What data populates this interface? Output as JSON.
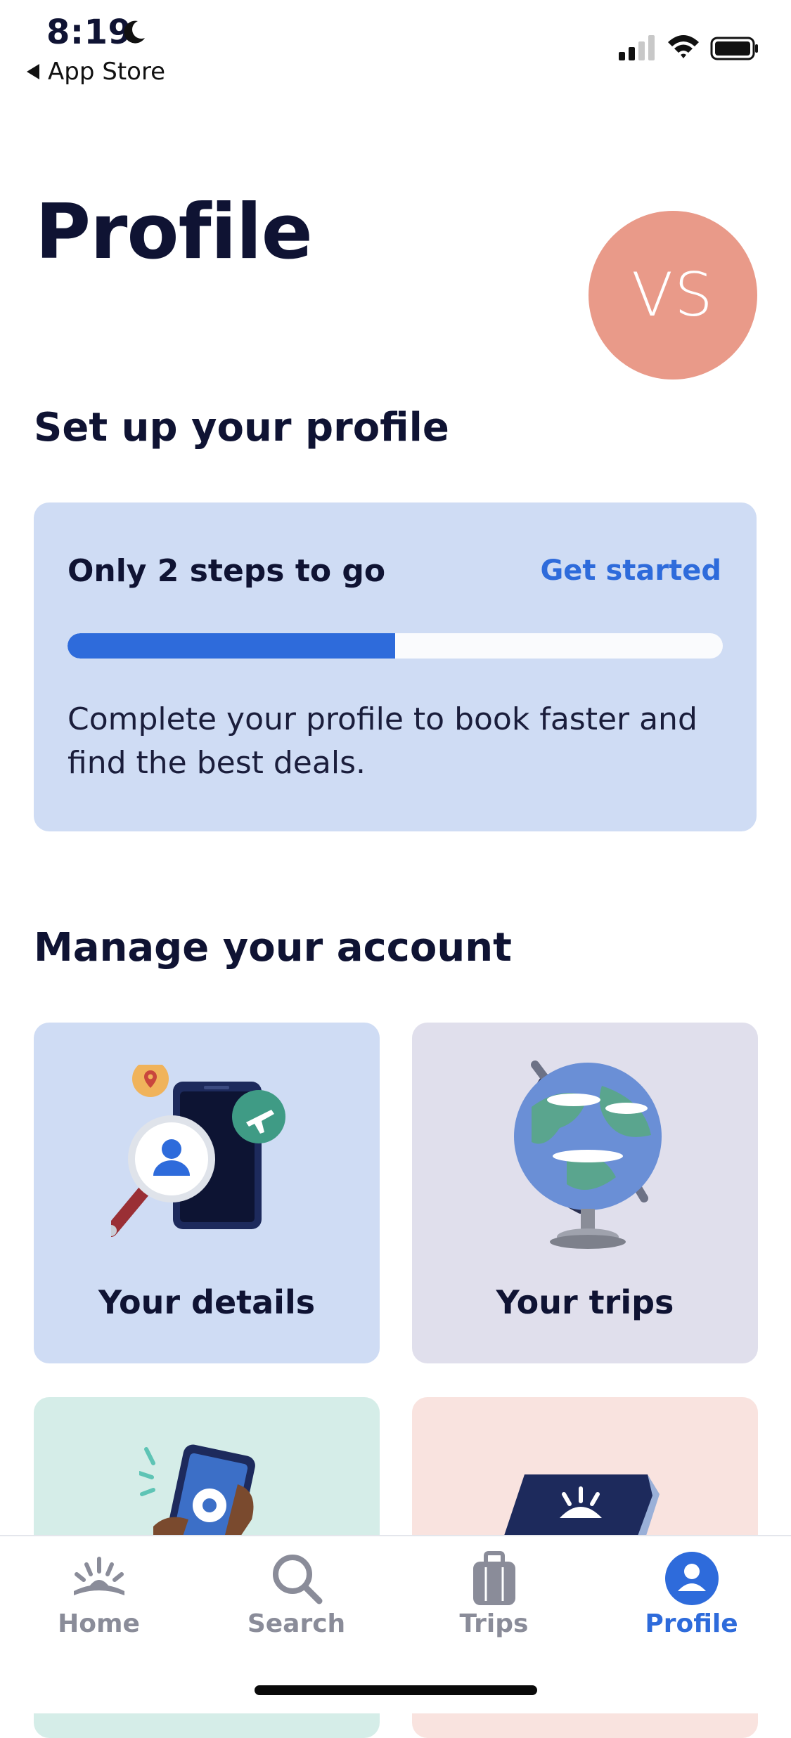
{
  "status_bar": {
    "time": "8:19",
    "back_label": "App Store"
  },
  "page": {
    "title": "Profile"
  },
  "avatar": {
    "initials": "VS",
    "color": "#e99a89"
  },
  "setup": {
    "heading": "Set up your profile",
    "steps_text": "Only 2 steps to go",
    "cta": "Get started",
    "progress": 0.5,
    "description": "Complete your profile to book faster and find the best deals."
  },
  "manage": {
    "heading": "Manage your account",
    "tiles": [
      {
        "label": "Your details",
        "bg": "#cfdcf4",
        "icon": "magnifier-phone-icon"
      },
      {
        "label": "Your trips",
        "bg": "#e0dfec",
        "icon": "globe-icon"
      },
      {
        "label": "",
        "bg": "#d5ede8",
        "icon": "phone-settings-icon"
      },
      {
        "label": "",
        "bg": "#f9e3df",
        "icon": "book-icon"
      }
    ]
  },
  "tabbar": {
    "tabs": [
      {
        "label": "Home",
        "icon": "sunrise-icon",
        "active": false
      },
      {
        "label": "Search",
        "icon": "search-icon",
        "active": false
      },
      {
        "label": "Trips",
        "icon": "luggage-icon",
        "active": false
      },
      {
        "label": "Profile",
        "icon": "person-icon",
        "active": true
      }
    ]
  },
  "colors": {
    "accent": "#2e6bdb",
    "text": "#0f1333",
    "inactive": "#8a8c99"
  }
}
